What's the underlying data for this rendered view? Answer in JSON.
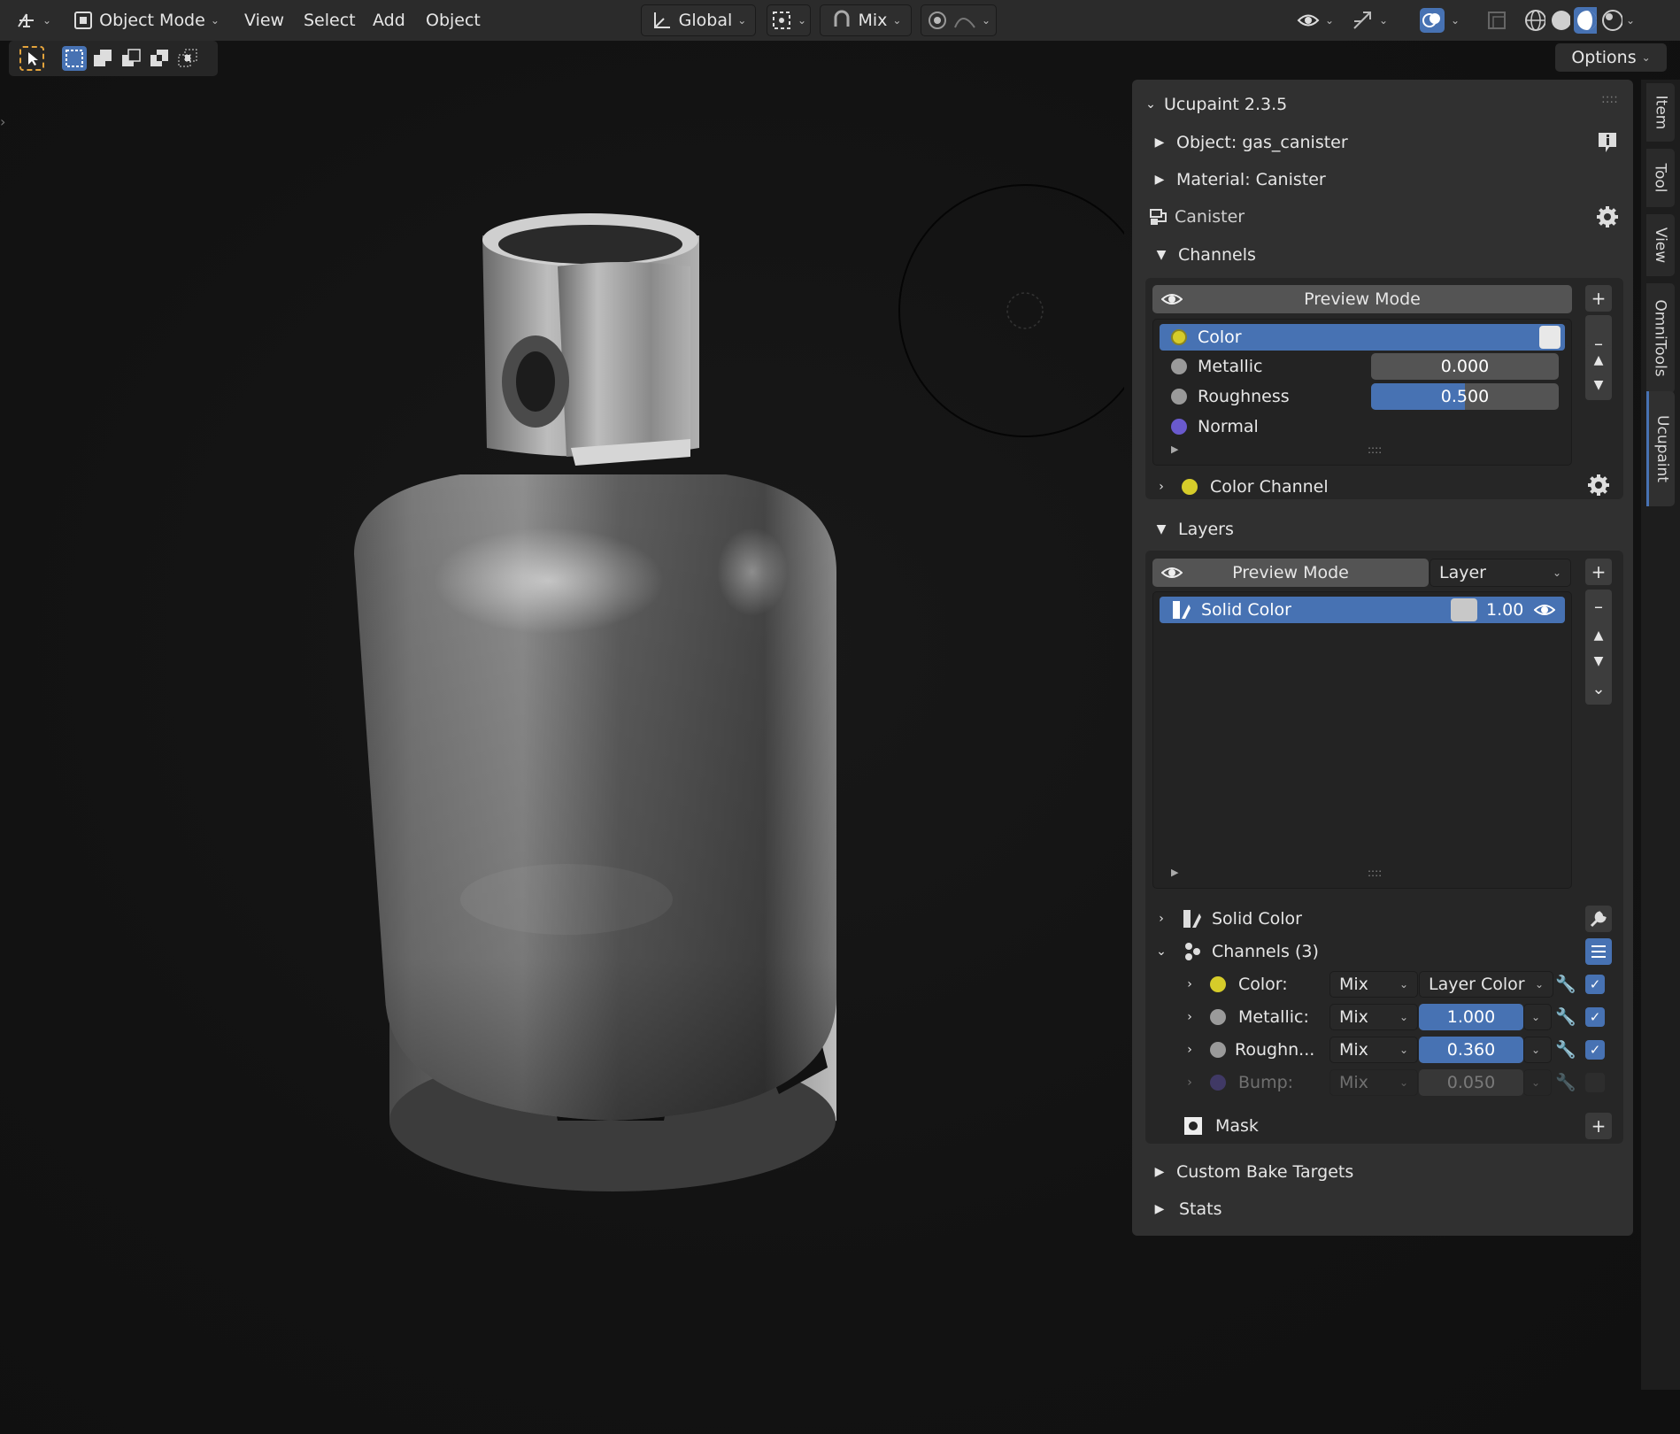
{
  "header": {
    "editor_icon": "editor-type-icon",
    "mode": "Object Mode",
    "menus": [
      "View",
      "Select",
      "Add",
      "Object"
    ],
    "orientation": "Global",
    "pivot_icon": "pivot-point-icon",
    "snap_icon": "snap-icon",
    "snap_mode": "Mix",
    "proportional_icon": "proportional-editing-icon",
    "falloff_icon": "falloff-curve-icon"
  },
  "toolbar": {
    "icons": [
      "select-tweak-icon",
      "select-box-icon",
      "mode-extend-icon",
      "mode-subtract-icon",
      "mode-difference-icon",
      "mode-intersect-icon"
    ]
  },
  "options_label": "Options",
  "sidebar_tabs": [
    "Item",
    "Tool",
    "View",
    "OmniTools",
    "Ucupaint"
  ],
  "panel": {
    "title": "Ucupaint 2.3.5",
    "object_label": "Object: gas_canister",
    "material_label": "Material: Canister",
    "node_label": "Canister",
    "channels_section": {
      "title": "Channels",
      "preview_mode": "Preview Mode",
      "items": [
        {
          "name": "Color",
          "value": "",
          "dot_color": "#d6cc2a"
        },
        {
          "name": "Metallic",
          "value": "0.000",
          "fraction": 0.0,
          "dot_color": "#9a9a9a"
        },
        {
          "name": "Roughness",
          "value": "0.500",
          "fraction": 0.5,
          "dot_color": "#9a9a9a"
        },
        {
          "name": "Normal",
          "value": "",
          "dot_color": "#6a5acd"
        }
      ],
      "color_swatch": "#e8e8e8",
      "color_channel_label": "Color Channel"
    },
    "layers_section": {
      "title": "Layers",
      "preview_mode": "Preview Mode",
      "preview_type": "Layer",
      "layer": {
        "name": "Solid Color",
        "opacity": "1.00",
        "swatch": "#c8c8c8"
      },
      "solid_color_label": "Solid Color",
      "channels_label": "Channels (3)",
      "layer_channels": [
        {
          "name": "Color:",
          "blend": "Mix",
          "value": "Layer Color",
          "enabled": true,
          "dot_color": "#d6cc2a"
        },
        {
          "name": "Metallic:",
          "blend": "Mix",
          "value": "1.000",
          "fraction": 1.0,
          "enabled": true,
          "dot_color": "#9a9a9a"
        },
        {
          "name": "Roughn...",
          "blend": "Mix",
          "value": "0.360",
          "fraction": 1.0,
          "enabled": true,
          "dot_color": "#9a9a9a"
        },
        {
          "name": "Bump:",
          "blend": "Mix",
          "value": "0.050",
          "fraction": 0.0,
          "enabled": false,
          "dot_color": "#6a5acd"
        }
      ],
      "mask_label": "Mask"
    },
    "custom_bake_label": "Custom Bake Targets",
    "stats_label": "Stats"
  },
  "colors": {
    "accent": "#4772b3",
    "panel": "#303030",
    "header": "#2b2b2b"
  }
}
